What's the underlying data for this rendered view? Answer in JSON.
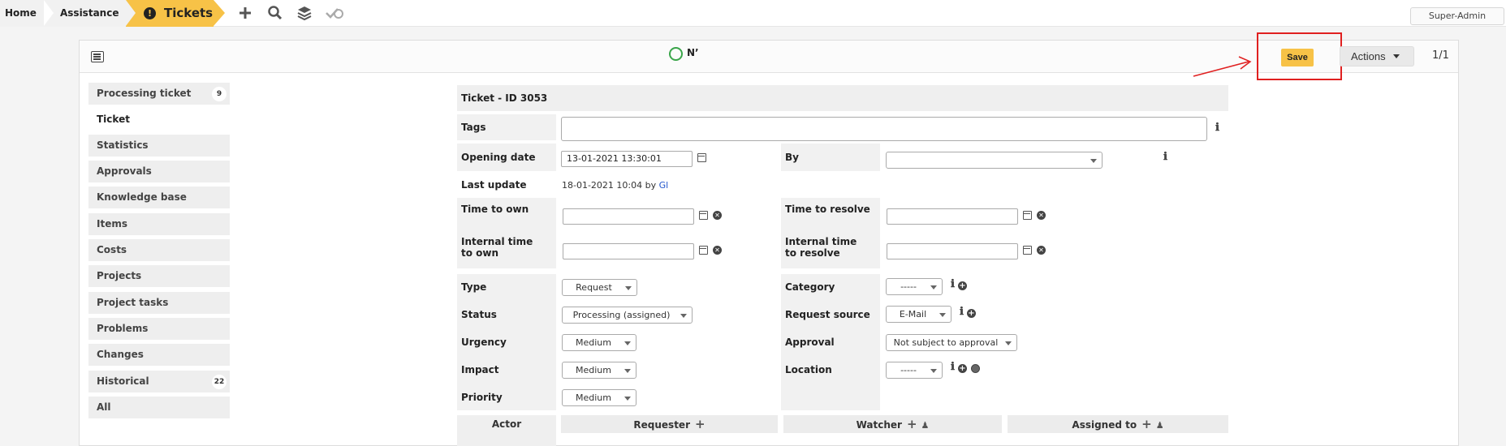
{
  "breadcrumb": {
    "home": "Home",
    "assistance": "Assistance",
    "tickets": "Tickets"
  },
  "topbar": {
    "user": "Super-Admin"
  },
  "header": {
    "status_text": "N’",
    "save_label": "Save",
    "actions_label": "Actions",
    "pager": "1/1"
  },
  "sidebar": {
    "items": [
      {
        "label": "Processing ticket",
        "badge": "9"
      },
      {
        "label": "Ticket",
        "badge": ""
      },
      {
        "label": "Statistics",
        "badge": ""
      },
      {
        "label": "Approvals",
        "badge": ""
      },
      {
        "label": "Knowledge base",
        "badge": ""
      },
      {
        "label": "Items",
        "badge": ""
      },
      {
        "label": "Costs",
        "badge": ""
      },
      {
        "label": "Projects",
        "badge": ""
      },
      {
        "label": "Project tasks",
        "badge": ""
      },
      {
        "label": "Problems",
        "badge": ""
      },
      {
        "label": "Changes",
        "badge": ""
      },
      {
        "label": "Historical",
        "badge": "22"
      },
      {
        "label": "All",
        "badge": ""
      }
    ]
  },
  "form": {
    "title": "Ticket - ID 3053",
    "tags_label": "Tags",
    "tags_value": "",
    "opening_date_label": "Opening date",
    "opening_date_value": "13-01-2021 13:30:01",
    "by_label": "By",
    "by_value": "",
    "last_update_label": "Last update",
    "last_update_value": "18-01-2021 10:04 by ",
    "last_update_user": "Gl",
    "time_to_own_label": "Time to own",
    "time_to_resolve_label": "Time to resolve",
    "internal_tto_label": "Internal time to own",
    "internal_ttr_label": "Internal time to resolve",
    "type_label": "Type",
    "type_value": "Request",
    "category_label": "Category",
    "category_value": "-----",
    "status_label": "Status",
    "status_value": "Processing (assigned)",
    "request_source_label": "Request source",
    "request_source_value": "E-Mail",
    "urgency_label": "Urgency",
    "urgency_value": "Medium",
    "approval_label": "Approval",
    "approval_value": "Not subject to approval",
    "impact_label": "Impact",
    "impact_value": "Medium",
    "location_label": "Location",
    "location_value": "-----",
    "priority_label": "Priority",
    "priority_value": "Medium"
  },
  "actors": {
    "actor_label": "Actor",
    "requester_label": "Requester",
    "watcher_label": "Watcher",
    "assigned_label": "Assigned to"
  },
  "colors": {
    "accent": "#f7c247",
    "highlight": "#e02020",
    "ok": "#3aa54a"
  }
}
